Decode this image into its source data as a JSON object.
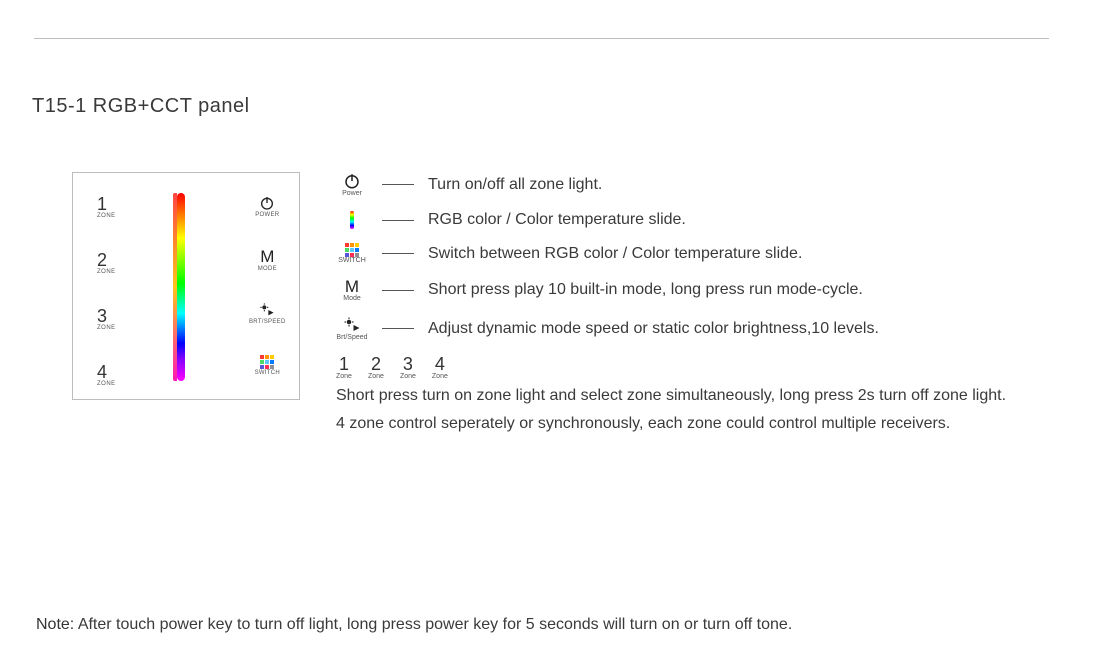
{
  "heading": "T15-1   RGB+CCT panel",
  "panel": {
    "zones": [
      {
        "num": "1",
        "label": "ZONE"
      },
      {
        "num": "2",
        "label": "ZONE"
      },
      {
        "num": "3",
        "label": "ZONE"
      },
      {
        "num": "4",
        "label": "ZONE"
      }
    ],
    "controls": {
      "power_label": "POWER",
      "mode_glyph": "M",
      "mode_label": "MODE",
      "brtspeed_label": "BRT/SPEED",
      "switch_label": "SWITCH"
    }
  },
  "legend": {
    "power": {
      "caption": "Power",
      "text": "Turn on/off all zone light."
    },
    "slide": {
      "caption": "",
      "text": "RGB color / Color temperature slide."
    },
    "switch": {
      "caption": "SWITCH",
      "text": "Switch between RGB color / Color temperature slide."
    },
    "mode": {
      "glyph": "M",
      "caption": "Mode",
      "text": "Short press play 10 built-in mode, long press run mode-cycle."
    },
    "brt": {
      "caption": "Brt/Speed",
      "text": "Adjust dynamic mode speed or static color brightness,10 levels."
    },
    "zones": [
      {
        "num": "1",
        "label": "Zone"
      },
      {
        "num": "2",
        "label": "Zone"
      },
      {
        "num": "3",
        "label": "Zone"
      },
      {
        "num": "4",
        "label": "Zone"
      }
    ],
    "zone_desc_line1": "Short press turn on zone light and select zone simultaneously, long press 2s turn off zone light.",
    "zone_desc_line2": "4 zone control seperately or synchronously, each zone could control multiple receivers."
  },
  "note": {
    "label": "Note:",
    "text": " After touch power key to turn off light, long press power key for 5 seconds will turn on or turn off tone."
  }
}
